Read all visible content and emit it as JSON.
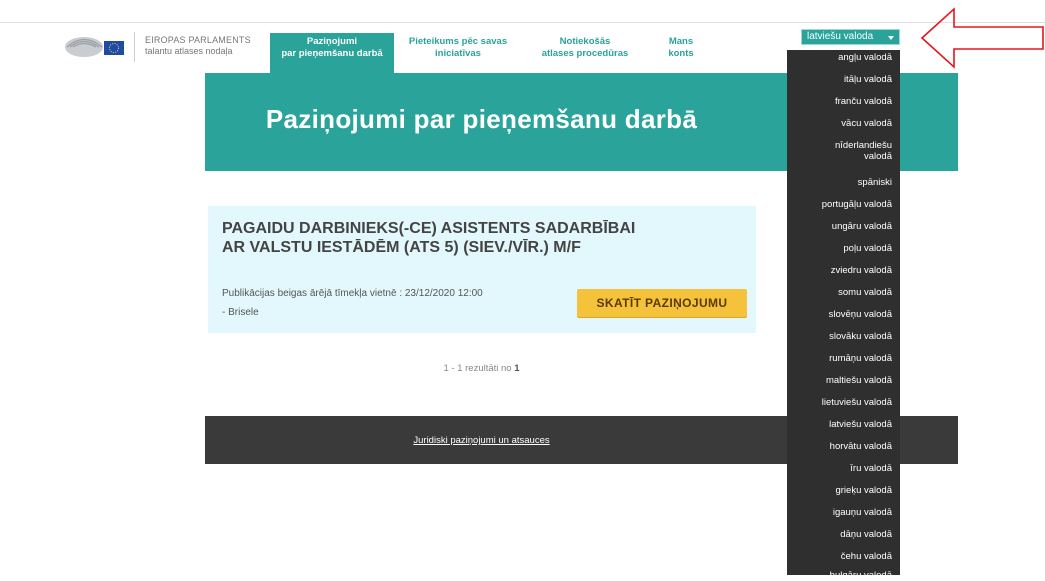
{
  "org": {
    "name": "EIROPAS PARLAMENTS",
    "unit": "talantu atlases nodaļa"
  },
  "nav": [
    {
      "line1": "Paziņojumi",
      "line2": "par pieņemšanu darbā",
      "active": true
    },
    {
      "line1": "Pieteikums pēc savas",
      "line2": "iniciatīvas",
      "active": false
    },
    {
      "line1": "Notiekošās",
      "line2": "atlases procedūras",
      "active": false
    },
    {
      "line1": "Mans",
      "line2": "konts",
      "active": false
    }
  ],
  "page_title": "Paziņojumi par pieņemšanu darbā",
  "listing": {
    "title": "PAGAIDU DARBINIEKS(-CE) ASISTENTS SADARBĪBAI AR VALSTU IESTĀDĒM (ATS 5) (SIEV./VĪR.) M/F",
    "date_line": "Publikācijas beigas ārējā tīmekļa vietnē : 23/12/2020 12:00",
    "location": "- Brisele",
    "button_label": "SKATĪT PAZIŅOJUMU"
  },
  "results": {
    "prefix": "1 - 1 rezultāti no ",
    "total": "1"
  },
  "footer": {
    "link": "Juridiski paziņojumi un atsauces"
  },
  "language": {
    "selected": "latviešu valoda",
    "options": [
      "angļu valodā",
      "itāļu valodā",
      "franču valodā",
      "vācu valodā",
      "nīderlandiešu valodā",
      "spāniski",
      "portugāļu valodā",
      "ungāru valodā",
      "poļu valodā",
      "zviedru valodā",
      "somu valodā",
      "slovēņu valodā",
      "slovāku valodā",
      "rumāņu valodā",
      "maltiešu valodā",
      "lietuviešu valodā",
      "latviešu valodā",
      "horvātu valodā",
      "īru valodā",
      "grieķu valodā",
      "igauņu valodā",
      "dāņu valodā",
      "čehu valodā",
      "bulgāru valodā"
    ]
  },
  "colors": {
    "teal": "#2aa39a",
    "button": "#f5c33b",
    "card": "#e3f8fc",
    "footer": "#3a3a3a",
    "annotation_arrow": "#e8141c"
  }
}
